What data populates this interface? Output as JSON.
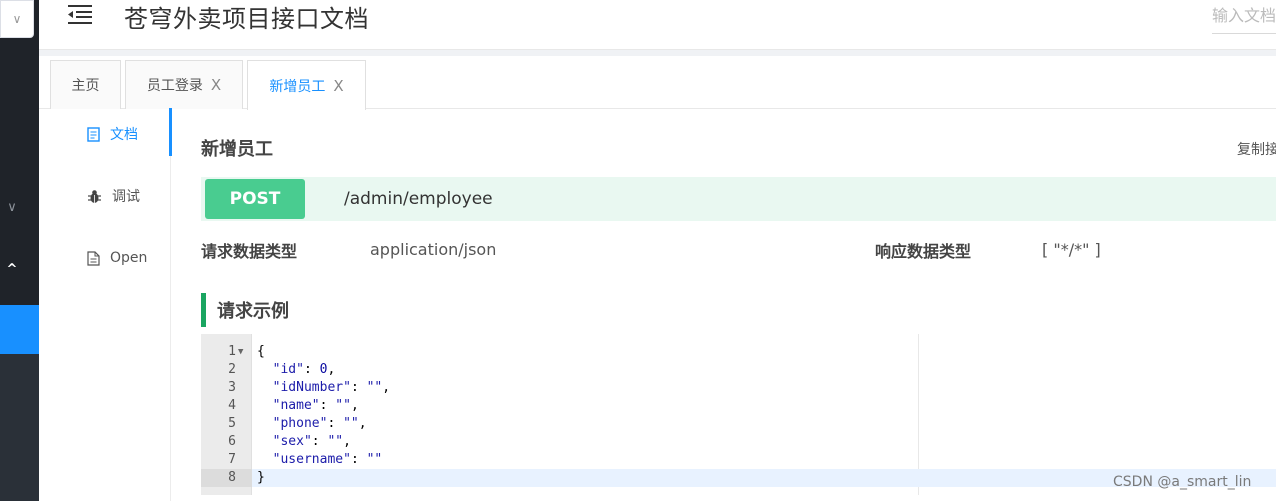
{
  "header": {
    "title": "苍穹外卖项目接口文档",
    "search_placeholder": "输入文档"
  },
  "tabs": [
    {
      "label": "主页",
      "closable": false,
      "active": false
    },
    {
      "label": "员工登录",
      "closable": true,
      "active": false
    },
    {
      "label": "新增员工",
      "closable": true,
      "active": true
    }
  ],
  "tab_close_glyph": "X",
  "inner_nav": [
    {
      "label": "文档",
      "icon": "document-icon",
      "active": true
    },
    {
      "label": "调试",
      "icon": "bug-icon",
      "active": false
    },
    {
      "label": "Open",
      "icon": "file-icon",
      "active": false
    }
  ],
  "api": {
    "title": "新增员工",
    "copy_label": "复制接",
    "method": "POST",
    "path": "/admin/employee",
    "request_type_label": "请求数据类型",
    "request_type_value": "application/json",
    "response_type_label": "响应数据类型",
    "response_type_value": "[ \"*/*\" ]",
    "example_section_title": "请求示例"
  },
  "code": {
    "lines": [
      {
        "num": "1",
        "text": "{",
        "fold": true
      },
      {
        "num": "2",
        "text": "  \"id\": 0,"
      },
      {
        "num": "3",
        "text": "  \"idNumber\": \"\","
      },
      {
        "num": "4",
        "text": "  \"name\": \"\","
      },
      {
        "num": "5",
        "text": "  \"phone\": \"\","
      },
      {
        "num": "6",
        "text": "  \"sex\": \"\","
      },
      {
        "num": "7",
        "text": "  \"username\": \"\""
      },
      {
        "num": "8",
        "text": "}",
        "active": true
      }
    ]
  },
  "watermark": "CSDN @a_smart_lin",
  "colors": {
    "accent": "#1890ff",
    "post": "#49cc90",
    "post_bg": "#e9f8f1",
    "sidebar": "#1f2329",
    "section_bar": "#1aa561"
  }
}
